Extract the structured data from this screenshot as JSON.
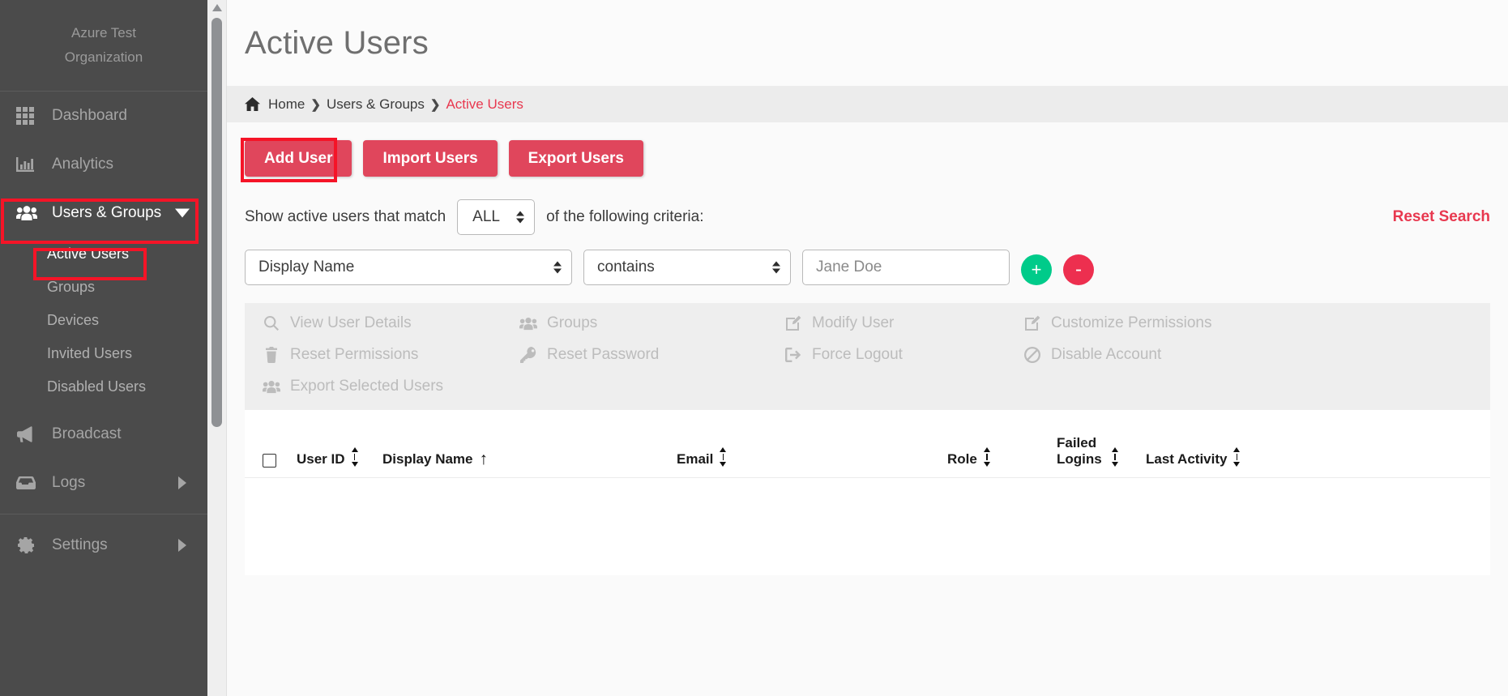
{
  "sidebar": {
    "org_line1": "Azure Test",
    "org_line2": "Organization",
    "items": [
      {
        "label": "Dashboard",
        "icon": "grid-icon"
      },
      {
        "label": "Analytics",
        "icon": "bar-chart-icon"
      },
      {
        "label": "Users & Groups",
        "icon": "users-icon",
        "caret": "chevron-down-icon"
      },
      {
        "label": "Broadcast",
        "icon": "megaphone-icon"
      },
      {
        "label": "Logs",
        "icon": "inbox-icon",
        "caret": "chevron-right-icon"
      },
      {
        "label": "Settings",
        "icon": "gear-icon",
        "caret": "chevron-right-icon"
      }
    ],
    "sub_items": [
      {
        "label": "Active Users"
      },
      {
        "label": "Groups"
      },
      {
        "label": "Devices"
      },
      {
        "label": "Invited Users"
      },
      {
        "label": "Disabled Users"
      }
    ]
  },
  "header": {
    "title": "Active Users"
  },
  "breadcrumb": {
    "home": "Home",
    "section": "Users & Groups",
    "current": "Active Users",
    "separator": "❯",
    "home_icon": "home-icon"
  },
  "toolbar": {
    "add_user": "Add User",
    "import_users": "Import Users",
    "export_users": "Export Users"
  },
  "filter": {
    "prefix_text": "Show active users that match",
    "match_value": "ALL",
    "suffix_text": "of the following criteria:",
    "reset_search": "Reset Search",
    "field_value": "Display Name",
    "operator_value": "contains",
    "value_placeholder": "Jane Doe",
    "value_current": "",
    "add_label": "+",
    "remove_label": "-"
  },
  "actions": [
    {
      "label": "View User Details",
      "icon": "search-icon"
    },
    {
      "label": "Groups",
      "icon": "users-icon"
    },
    {
      "label": "Modify User",
      "icon": "edit-icon"
    },
    {
      "label": "Customize Permissions",
      "icon": "edit-icon"
    },
    {
      "label": "Reset Permissions",
      "icon": "trash-icon"
    },
    {
      "label": "Reset Password",
      "icon": "key-icon"
    },
    {
      "label": "Force Logout",
      "icon": "logout-icon"
    },
    {
      "label": "Disable Account",
      "icon": "ban-icon"
    },
    {
      "label": "Export Selected Users",
      "icon": "users-icon"
    }
  ],
  "table": {
    "select_all_label": "",
    "columns": [
      {
        "label": "User ID",
        "sort": "sort-both-icon"
      },
      {
        "label": "Display Name",
        "sort": "sort-asc-icon"
      },
      {
        "label": "Email",
        "sort": "sort-both-icon"
      },
      {
        "label": "Role",
        "sort": "sort-both-icon"
      },
      {
        "label": "Failed Logins",
        "sort": "sort-both-icon"
      },
      {
        "label": "Last Activity",
        "sort": "sort-both-icon"
      }
    ],
    "rows": []
  },
  "colors": {
    "accent_red": "#e0465c",
    "breadcrumb_current": "#e8384f",
    "highlight_box": "#f51427",
    "sidebar_bg": "#4b4b4b",
    "add_circle_green": "#00cb8a",
    "remove_circle_red": "#ed2f4f"
  }
}
